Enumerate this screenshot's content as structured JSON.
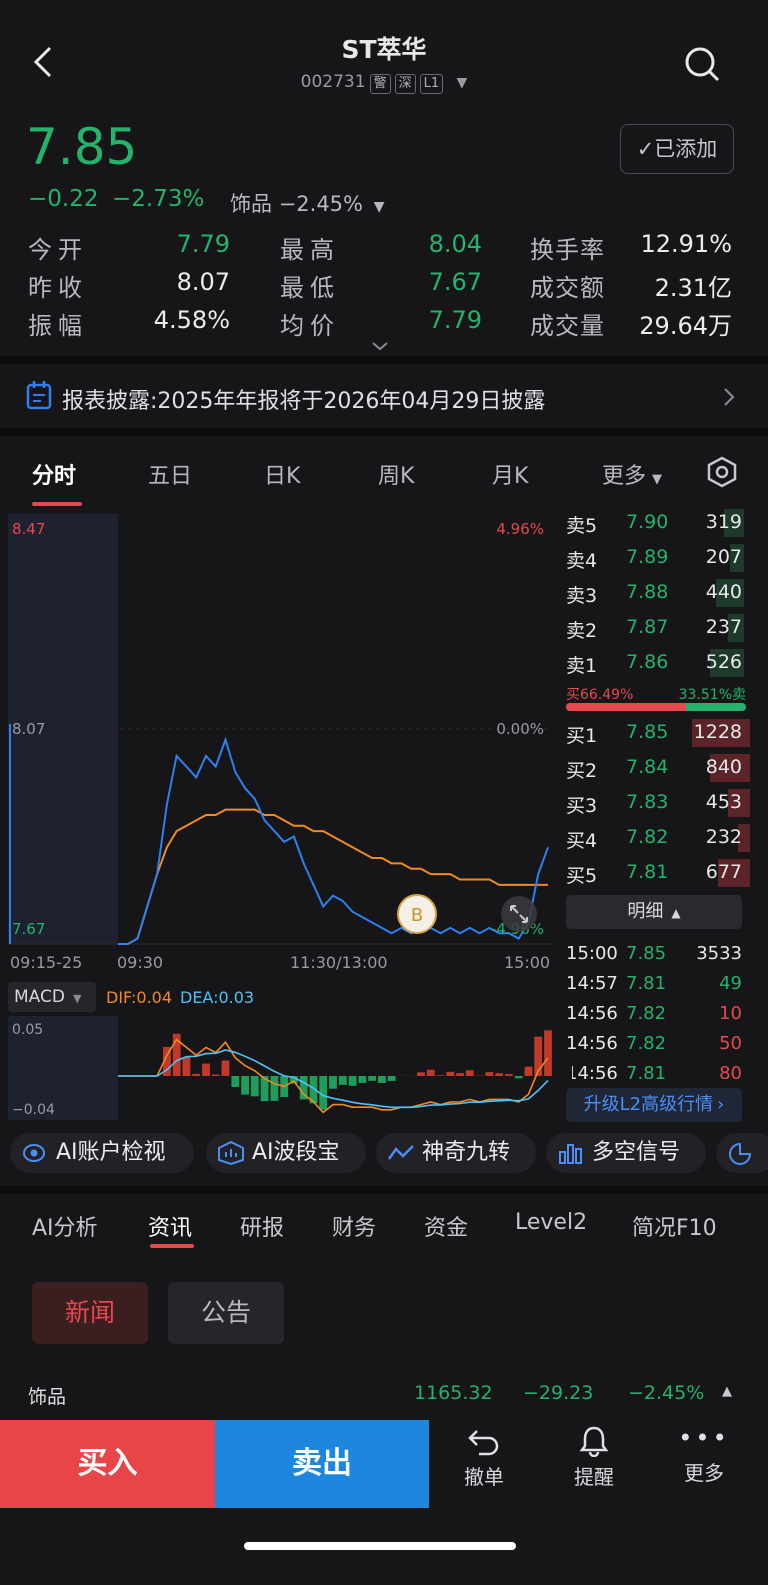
{
  "header": {
    "title": "ST萃华",
    "code": "002731",
    "tags": [
      "警",
      "深",
      "L1"
    ],
    "added_label": "已添加"
  },
  "price": {
    "last": "7.85",
    "change": "−0.22",
    "change_pct": "−2.73%",
    "sector_name": "饰品",
    "sector_pct": "−2.45%"
  },
  "stats": [
    {
      "label": "今开",
      "value": "7.79",
      "color": "green"
    },
    {
      "label": "最高",
      "value": "8.04",
      "color": "green"
    },
    {
      "label": "换手率",
      "value": "12.91%",
      "color": "white"
    },
    {
      "label": "昨收",
      "value": "8.07",
      "color": "white"
    },
    {
      "label": "最低",
      "value": "7.67",
      "color": "green"
    },
    {
      "label": "成交额",
      "value": "2.31亿",
      "color": "white"
    },
    {
      "label": "振幅",
      "value": "4.58%",
      "color": "white"
    },
    {
      "label": "均价",
      "value": "7.79",
      "color": "green"
    },
    {
      "label": "成交量",
      "value": "29.64万",
      "color": "white"
    }
  ],
  "notice": {
    "text": "报表披露:2025年年报将于2026年04月29日披露"
  },
  "chart_tabs": [
    "分时",
    "五日",
    "日K",
    "周K",
    "月K",
    "更多"
  ],
  "chart": {
    "price_top": "8.47",
    "price_mid": "8.07",
    "price_bottom": "7.67",
    "pct_top": "4.96%",
    "pct_mid": "0.00%",
    "pct_bottom": "-4.96%",
    "times": [
      "09:15-25",
      "09:30",
      "11:30/13:00",
      "15:00"
    ],
    "marker": "B"
  },
  "chart_data": {
    "type": "line",
    "title": "",
    "ylim": [
      7.67,
      8.47
    ],
    "series": [
      {
        "values": [
          7.67,
          7.67,
          7.68,
          7.74,
          7.8,
          7.93,
          8.02,
          8.0,
          7.98,
          8.02,
          8.0,
          8.05,
          7.99,
          7.96,
          7.94,
          7.9,
          7.88,
          7.86,
          7.87,
          7.82,
          7.78,
          7.74,
          7.76,
          7.75,
          7.73,
          7.72,
          7.71,
          7.7,
          7.69,
          7.7,
          7.69,
          7.7,
          7.7,
          7.69,
          7.7,
          7.69,
          7.7,
          7.69,
          7.7,
          7.69,
          7.69,
          7.68,
          7.71,
          7.8,
          7.85
        ]
      },
      {
        "values": [
          7.67,
          7.67,
          7.68,
          7.74,
          7.8,
          7.85,
          7.88,
          7.89,
          7.9,
          7.91,
          7.91,
          7.92,
          7.92,
          7.92,
          7.92,
          7.91,
          7.91,
          7.9,
          7.89,
          7.89,
          7.88,
          7.88,
          7.87,
          7.86,
          7.85,
          7.84,
          7.83,
          7.83,
          7.82,
          7.82,
          7.81,
          7.81,
          7.8,
          7.8,
          7.8,
          7.79,
          7.79,
          7.79,
          7.79,
          7.78,
          7.78,
          7.78,
          7.78,
          7.78,
          7.78
        ]
      }
    ]
  },
  "macd": {
    "label": "MACD",
    "dif": "DIF:0.04",
    "dea": "DEA:0.03",
    "top": "0.05",
    "bottom": "−0.04"
  },
  "orderbook": {
    "sell": [
      [
        "卖5",
        "7.90",
        "319"
      ],
      [
        "卖4",
        "7.89",
        "207"
      ],
      [
        "卖3",
        "7.88",
        "440"
      ],
      [
        "卖2",
        "7.87",
        "237"
      ],
      [
        "卖1",
        "7.86",
        "526"
      ]
    ],
    "buy": [
      [
        "买1",
        "7.85",
        "1228"
      ],
      [
        "买2",
        "7.84",
        "840"
      ],
      [
        "买3",
        "7.83",
        "453"
      ],
      [
        "买4",
        "7.82",
        "232"
      ],
      [
        "买5",
        "7.81",
        "677"
      ]
    ],
    "buy_ratio": "买66.49%",
    "sell_ratio": "33.51%卖",
    "buy_fraction": 0.6649,
    "detail_label": "明细"
  },
  "deals": [
    [
      "15:00",
      "7.85",
      "3533",
      "white"
    ],
    [
      "14:57",
      "7.81",
      "49",
      "green"
    ],
    [
      "14:56",
      "7.82",
      "10",
      "red"
    ],
    [
      "14:56",
      "7.82",
      "50",
      "red"
    ],
    [
      "14:56",
      "7.81",
      "80",
      "red"
    ]
  ],
  "upgrade_label": "升级L2高级行情",
  "tools": [
    "AI账户检视",
    "AI波段宝",
    "神奇九转",
    "多空信号"
  ],
  "info_tabs": [
    "AI分析",
    "资讯",
    "研报",
    "财务",
    "资金",
    "Level2",
    "简况F10"
  ],
  "news_buttons": [
    "新闻",
    "公告"
  ],
  "sector_row": {
    "name": "饰品",
    "value": "1165.32",
    "change": "−29.23",
    "pct": "−2.45%"
  },
  "bottom": {
    "buy": "买入",
    "sell": "卖出",
    "cancel": "撤单",
    "alert": "提醒",
    "more": "更多"
  },
  "colors": {
    "green": "#23b36b",
    "red": "#e5484d",
    "blue": "#2e7ff0",
    "orange": "#f08a24",
    "cyan": "#4fc3f7"
  }
}
